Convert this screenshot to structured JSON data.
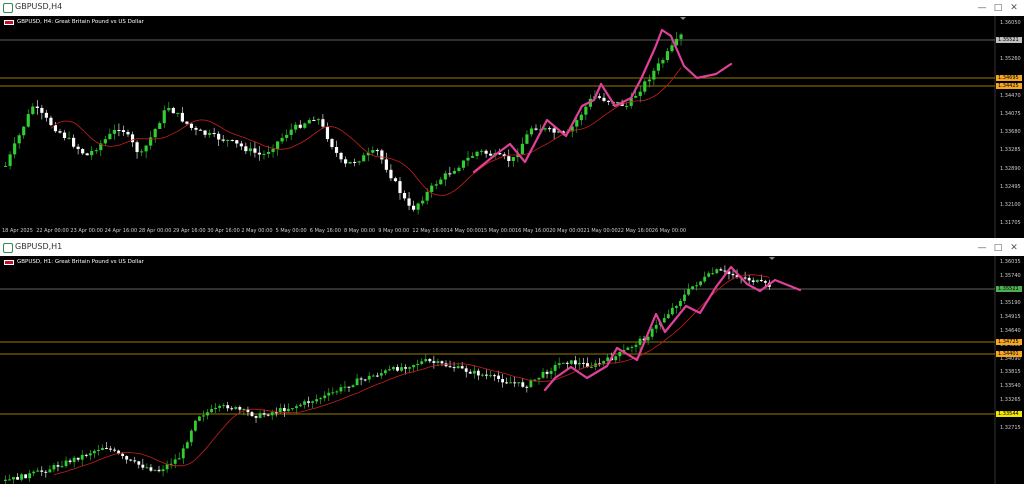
{
  "windows": [
    {
      "title": "GBPUSD,H4",
      "label": "GBPUSD, H4:  Great Britain Pound vs US Dollar",
      "price_labels": [
        "1.36050",
        "1.35655",
        "1.35260",
        "1.34865",
        "1.34470",
        "1.34075",
        "1.33680",
        "1.33285",
        "1.32890",
        "1.32495",
        "1.32100",
        "1.31705"
      ],
      "time_labels": [
        "18 Apr 2025",
        "22 Apr 00:00",
        "23 Apr 00:00",
        "24 Apr 16:00",
        "28 Apr 00:00",
        "29 Apr 16:00",
        "30 Apr 16:00",
        "2 May 00:00",
        "5 May 00:00",
        "6 May 16:00",
        "8 May 00:00",
        "9 May 00:00",
        "12 May 16:00",
        "14 May 00:00",
        "15 May 00:00",
        "16 May 16:00",
        "20 May 00:00",
        "21 May 00:00",
        "22 May 16:00",
        "26 May 00:00"
      ],
      "tags": [
        {
          "text": "1.35521",
          "bg": "#c0c0c0"
        },
        {
          "text": "1.34695",
          "bg": "#f5a623"
        },
        {
          "text": "1.34425",
          "bg": "#f5a623"
        }
      ]
    },
    {
      "title": "GBPUSD,H1",
      "label": "GBPUSD, H1:  Great Britain Pound vs US Dollar",
      "price_labels": [
        "1.36035",
        "1.35740",
        "1.35465",
        "1.35190",
        "1.34915",
        "1.34640",
        "1.34365",
        "1.34090",
        "1.33815",
        "1.33540",
        "1.33265",
        "1.32990",
        "1.32715"
      ],
      "tags": [
        {
          "text": "1.35521",
          "bg": "#4caf50"
        },
        {
          "text": "1.34725",
          "bg": "#f5a623"
        },
        {
          "text": "1.34401",
          "bg": "#f5a623"
        },
        {
          "text": "1.33544",
          "bg": "#f2e600"
        }
      ]
    }
  ],
  "colors": {
    "bull": "#32cd32",
    "bear": "#ffffff",
    "ma": "#c81e1e",
    "draw": "#e0409a",
    "hline": "#c8a000",
    "hline_gray": "#808080"
  },
  "icons": [
    "chart-icon",
    "minimize-icon",
    "maximize-icon",
    "close-icon"
  ]
}
